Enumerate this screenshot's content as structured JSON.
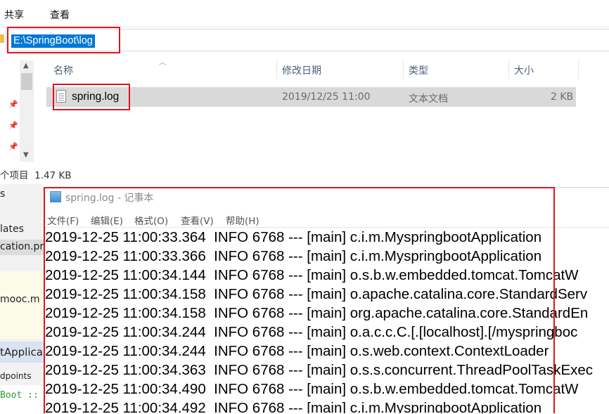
{
  "ribbon": {
    "tabs": [
      "共享",
      "查看"
    ]
  },
  "address_bar": {
    "path": "E:\\SpringBoot\\log"
  },
  "file_list": {
    "columns": [
      "名称",
      "修改日期",
      "类型",
      "大小"
    ],
    "files": [
      {
        "name": "spring.log",
        "modified": "2019/12/25 11:00",
        "type": "文本文档",
        "size": "2 KB"
      }
    ]
  },
  "status_bar": {
    "text": "个项目  1.47 KB"
  },
  "ide_fragment": {
    "lines": [
      "s",
      "lates",
      "cation.pr",
      "mooc.m",
      "tApplica",
      "dpoints",
      "Boot ::"
    ]
  },
  "notepad": {
    "title": "spring.log - 记事本",
    "menu": [
      "文件(F)",
      "编辑(E)",
      "格式(O)",
      "查看(V)",
      "帮助(H)"
    ],
    "lines": [
      "2019-12-25 11:00:33.364  INFO 6768 --- [main] c.i.m.MyspringbootApplication",
      "2019-12-25 11:00:33.366  INFO 6768 --- [main] c.i.m.MyspringbootApplication",
      "2019-12-25 11:00:34.144  INFO 6768 --- [main] o.s.b.w.embedded.tomcat.TomcatW",
      "2019-12-25 11:00:34.158  INFO 6768 --- [main] o.apache.catalina.core.StandardServ",
      "2019-12-25 11:00:34.158  INFO 6768 --- [main] org.apache.catalina.core.StandardEn",
      "2019-12-25 11:00:34.244  INFO 6768 --- [main] o.a.c.c.C.[.[localhost].[/myspringboc",
      "2019-12-25 11:00:34.244  INFO 6768 --- [main] o.s.web.context.ContextLoader",
      "2019-12-25 11:00:34.363  INFO 6768 --- [main] o.s.s.concurrent.ThreadPoolTaskExec",
      "2019-12-25 11:00:34.490  INFO 6768 --- [main] o.s.b.w.embedded.tomcat.TomcatW",
      "2019-12-25 11:00:34.492  INFO 6768 --- [main] c.i.m.MyspringbootApplication"
    ]
  },
  "colors": {
    "highlight_red": "#e0141e",
    "selection_blue": "#0078d7"
  }
}
